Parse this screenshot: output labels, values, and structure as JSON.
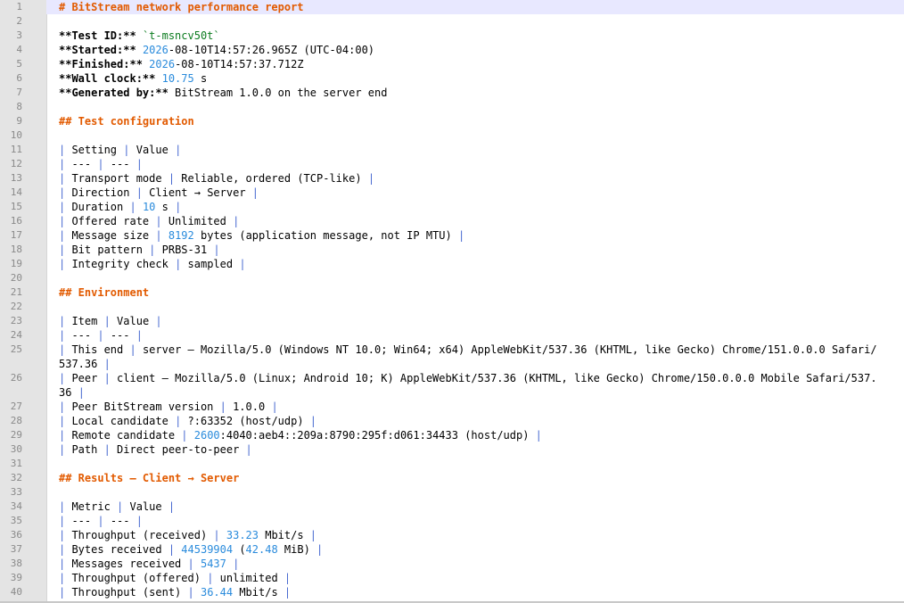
{
  "editor": {
    "lines": [
      {
        "n": "1",
        "text": "# BitStream network performance report"
      },
      {
        "n": "2",
        "text": ""
      },
      {
        "n": "3",
        "text": "**Test ID:** `t-msncv50t`"
      },
      {
        "n": "4",
        "text": "**Started:** 2026-08-10T14:57:26.965Z (UTC-04:00)"
      },
      {
        "n": "5",
        "text": "**Finished:** 2026-08-10T14:57:37.712Z"
      },
      {
        "n": "6",
        "text": "**Wall clock:** 10.75 s"
      },
      {
        "n": "7",
        "text": "**Generated by:** BitStream 1.0.0 on the server end"
      },
      {
        "n": "8",
        "text": ""
      },
      {
        "n": "9",
        "text": "## Test configuration"
      },
      {
        "n": "10",
        "text": ""
      },
      {
        "n": "11",
        "text": "| Setting | Value |"
      },
      {
        "n": "12",
        "text": "| --- | --- |"
      },
      {
        "n": "13",
        "text": "| Transport mode | Reliable, ordered (TCP-like) |"
      },
      {
        "n": "14",
        "text": "| Direction | Client → Server |"
      },
      {
        "n": "15",
        "text": "| Duration | 10 s |"
      },
      {
        "n": "16",
        "text": "| Offered rate | Unlimited |"
      },
      {
        "n": "17",
        "text": "| Message size | 8192 bytes (application message, not IP MTU) |"
      },
      {
        "n": "18",
        "text": "| Bit pattern | PRBS-31 |"
      },
      {
        "n": "19",
        "text": "| Integrity check | sampled |"
      },
      {
        "n": "20",
        "text": ""
      },
      {
        "n": "21",
        "text": "## Environment"
      },
      {
        "n": "22",
        "text": ""
      },
      {
        "n": "23",
        "text": "| Item | Value |"
      },
      {
        "n": "24",
        "text": "| --- | --- |"
      },
      {
        "n": "25",
        "text": "| This end | server — Mozilla/5.0 (Windows NT 10.0; Win64; x64) AppleWebKit/537.36 (KHTML, like Gecko) Chrome/151.0.0.0 Safari/537.36 |"
      },
      {
        "n": "26",
        "text": "| Peer | client — Mozilla/5.0 (Linux; Android 10; K) AppleWebKit/537.36 (KHTML, like Gecko) Chrome/150.0.0.0 Mobile Safari/537.36 |"
      },
      {
        "n": "27",
        "text": "| Peer BitStream version | 1.0.0 |"
      },
      {
        "n": "28",
        "text": "| Local candidate | ?:63352 (host/udp) |"
      },
      {
        "n": "29",
        "text": "| Remote candidate | 2600:4040:aeb4::209a:8790:295f:d061:34433 (host/udp) |"
      },
      {
        "n": "30",
        "text": "| Path | Direct peer-to-peer |"
      },
      {
        "n": "31",
        "text": ""
      },
      {
        "n": "32",
        "text": "## Results — Client → Server"
      },
      {
        "n": "33",
        "text": ""
      },
      {
        "n": "34",
        "text": "| Metric | Value |"
      },
      {
        "n": "35",
        "text": "| --- | --- |"
      },
      {
        "n": "36",
        "text": "| Throughput (received) | 33.23 Mbit/s |"
      },
      {
        "n": "37",
        "text": "| Bytes received | 44539904 (42.48 MiB) |"
      },
      {
        "n": "38",
        "text": "| Messages received | 5437 |"
      },
      {
        "n": "39",
        "text": "| Throughput (offered) | unlimited |"
      },
      {
        "n": "40",
        "text": "| Throughput (sent) | 36.44 Mbit/s |"
      }
    ]
  },
  "colors": {
    "heading": "#e25a00",
    "number": "#2a8bdc",
    "code": "#0a7b1e",
    "pipe": "#4a6bd1",
    "current_line": "#e8e8ff",
    "gutter": "#e4e4e4"
  }
}
